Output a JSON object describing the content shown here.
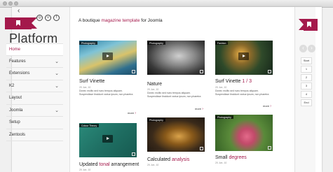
{
  "sidebar": {
    "back": "‹",
    "logo": "Platform",
    "social": [
      "◎",
      "v",
      "f"
    ],
    "items": [
      {
        "label": "Home",
        "chevron": false
      },
      {
        "label": "Features",
        "chevron": true
      },
      {
        "label": "Extensions",
        "chevron": true
      },
      {
        "label": "K2",
        "chevron": true
      },
      {
        "label": "Layout",
        "chevron": false
      },
      {
        "label": "Joomla",
        "chevron": true
      },
      {
        "label": "Setup",
        "chevron": false
      },
      {
        "label": "Zentools",
        "chevron": false
      }
    ]
  },
  "header": {
    "tagline_pre": "A boutique ",
    "tagline_hl": "magazine template",
    "tagline_post": " for Joomla"
  },
  "cards": [
    {
      "tag": "Photography",
      "title": "Surf Vinette",
      "title_hl": "",
      "date": "20 Jun, 10",
      "body": "Donec mollis sed nunc tempus aliquam. Suspendisse tincidunt varius ipsum, non pharetra",
      "more": "more",
      "has_play": true
    },
    {
      "tag": "Photography",
      "title": "Nature",
      "title_hl": "",
      "date": "20 Jun, 10",
      "body": "Donec mollis sed nunc tempus aliquam. Suspendisse tincidunt varius ipsum, non pharetra",
      "more": "more",
      "has_play": false
    },
    {
      "tag": "Fashion",
      "title": "Surf Vinette ",
      "title_hl": "1 / 3",
      "date": "20 Jun, 10",
      "body": "Donec mollis sed nunc tempus aliquam. Suspendisse tincidunt varius ipsum, non pharetra",
      "more": "more",
      "has_play": true
    },
    {
      "tag": "Colour Theory",
      "title": "Updated ",
      "title_hl": "tonal",
      "title_post": " arrangement",
      "date": "20 Jun, 10",
      "body": "",
      "more": "",
      "has_play": true
    },
    {
      "tag": "Photography",
      "title": "Calculated ",
      "title_hl": "analysis",
      "date": "20 Jun, 10",
      "body": "",
      "more": "",
      "has_play": false
    },
    {
      "tag": "Photography",
      "title": "Small ",
      "title_hl": "degrees",
      "date": "20 Jun, 10",
      "body": "",
      "more": "",
      "has_play": false
    }
  ],
  "pagination": {
    "prev": "‹",
    "next": "›",
    "items": [
      "Start",
      "1",
      "2",
      "3",
      "4",
      "End"
    ]
  },
  "colors": {
    "accent": "#a4194b"
  },
  "icons": {
    "ribbon": "bookmark-icon",
    "play": "play-icon",
    "fullscreen": "fullscreen-icon"
  }
}
